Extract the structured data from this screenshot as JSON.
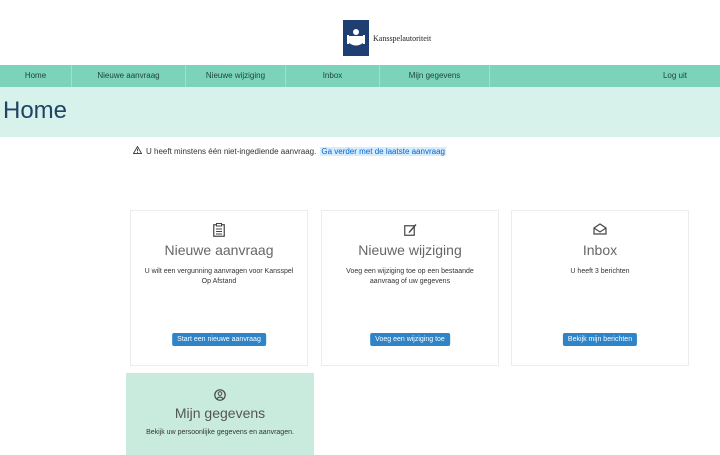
{
  "header": {
    "brand": "Kansspelautoriteit"
  },
  "nav": {
    "items": [
      "Home",
      "Nieuwe aanvraag",
      "Nieuwe wijziging",
      "Inbox",
      "Mijn gegevens"
    ],
    "logout": "Log uit"
  },
  "page": {
    "title": "Home"
  },
  "notice": {
    "text": "U heeft minstens één niet-ingediende aanvraag.",
    "link": "Ga verder met de laatste aanvraag"
  },
  "cards": [
    {
      "icon": "clipboard-list-icon",
      "title": "Nieuwe aanvraag",
      "text": "U wilt een vergunning aanvragen voor Kansspel Op Afstand",
      "button": "Start een nieuwe aanvraag"
    },
    {
      "icon": "edit-pencil-icon",
      "title": "Nieuwe wijziging",
      "text": "Voeg een wijziging toe op een bestaande aanvraag of uw gegevens",
      "button": "Voeg een wijziging toe"
    },
    {
      "icon": "envelope-icon",
      "title": "Inbox",
      "text": "U heeft 3 berichten",
      "button": "Bekijk mijn berichten"
    },
    {
      "icon": "user-circle-icon",
      "title": "Mijn gegevens",
      "text": "Bekijk uw persoonlijke gegevens en aanvragen."
    }
  ],
  "colors": {
    "nav": "#7bd4b9",
    "hero": "#d6f2ea",
    "button": "#2e84c7",
    "highlight_card": "#c9ebde",
    "logo": "#1f3f73"
  }
}
